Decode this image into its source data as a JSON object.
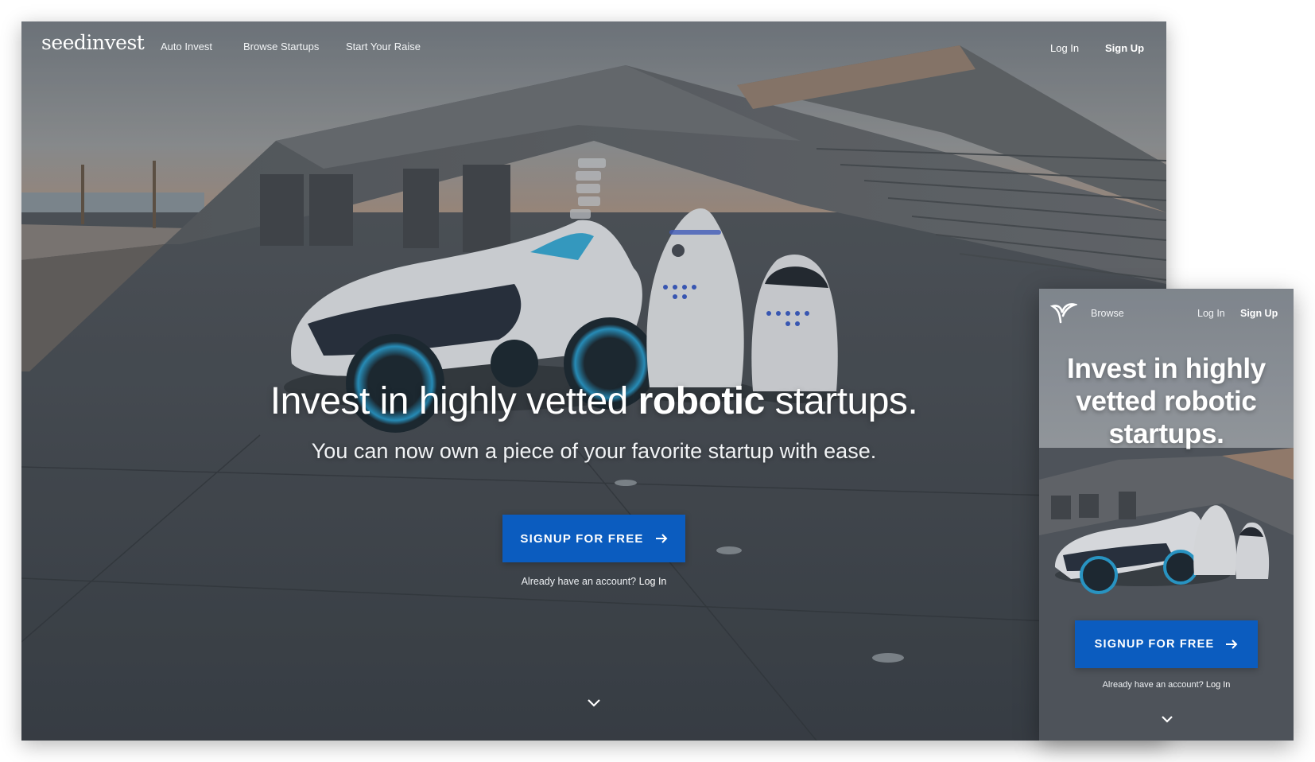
{
  "desktop": {
    "logo_text": "seedinvest",
    "nav": {
      "links": [
        "Auto Invest",
        "Browse Startups",
        "Start Your Raise"
      ],
      "login": "Log In",
      "signup": "Sign Up"
    },
    "hero": {
      "title_pre": "Invest in highly vetted ",
      "title_bold": "robotic",
      "title_post": " startups.",
      "subtitle": "You can now own a piece of your favorite startup with ease."
    },
    "cta_label": "SIGNUP FOR FREE",
    "already_text": "Already have an account? ",
    "already_link": "Log In"
  },
  "mobile": {
    "nav": {
      "browse": "Browse",
      "login": "Log In",
      "signup": "Sign Up"
    },
    "title_line1": "Invest in highly",
    "title_line2_pre": "vetted ",
    "title_line2_bold": "robotic",
    "title_line3": "startups.",
    "cta_label": "SIGNUP FOR FREE",
    "already_text": "Already have an account? ",
    "already_link": "Log In"
  },
  "colors": {
    "cta": "#0b5cbf",
    "text": "#ffffff"
  },
  "icons": {
    "cta_arrow": "arrow-right-icon",
    "scroll": "chevron-down-icon",
    "mobile_logo": "sprout-icon"
  }
}
